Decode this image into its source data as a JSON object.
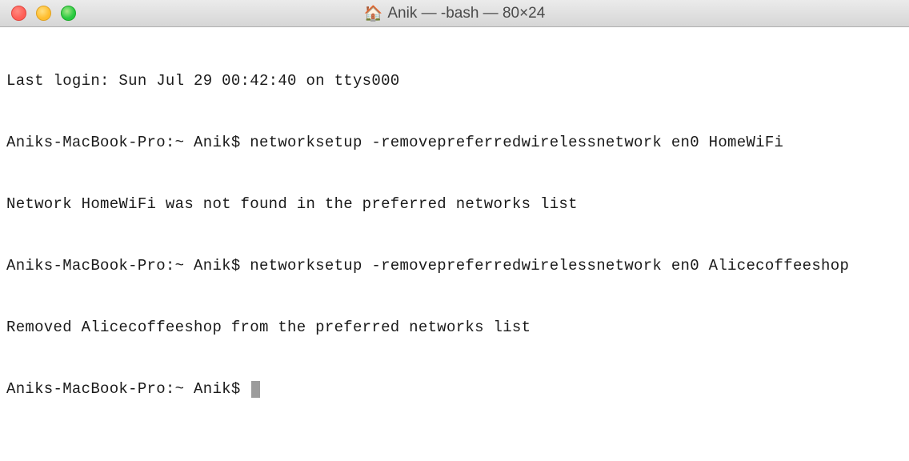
{
  "titlebar": {
    "home_icon": "🏠",
    "title": "Anik — -bash — 80×24"
  },
  "terminal": {
    "lines": [
      "Last login: Sun Jul 29 00:42:40 on ttys000",
      "Aniks-MacBook-Pro:~ Anik$ networksetup -removepreferredwirelessnetwork en0 HomeWiFi",
      "Network HomeWiFi was not found in the preferred networks list",
      "Aniks-MacBook-Pro:~ Anik$ networksetup -removepreferredwirelessnetwork en0 Alicecoffeeshop",
      "Removed Alicecoffeeshop from the preferred networks list",
      "Aniks-MacBook-Pro:~ Anik$ "
    ]
  },
  "colors": {
    "titlebar_bg_top": "#ebebeb",
    "titlebar_bg_bottom": "#d6d6d6",
    "close": "#ff5f57",
    "minimize": "#ffbd2e",
    "zoom": "#28c940",
    "text": "#1a1a1a",
    "cursor": "#9c9c9c"
  }
}
